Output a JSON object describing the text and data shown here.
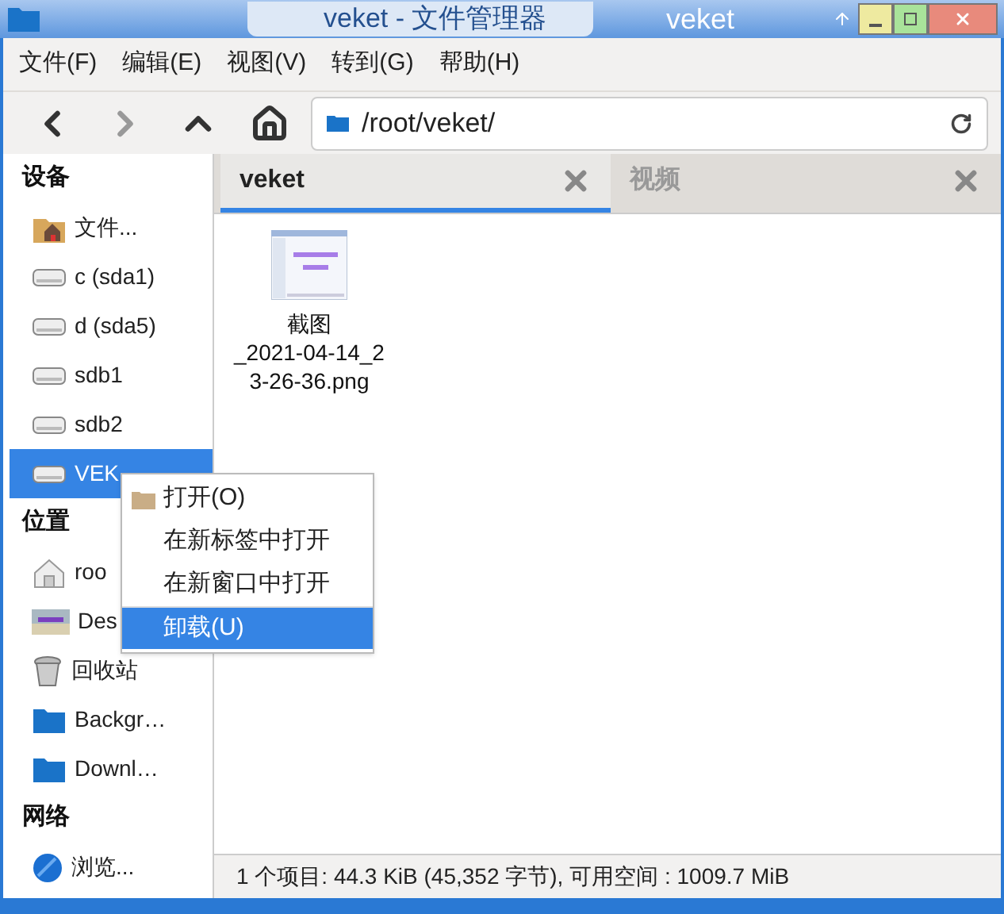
{
  "window": {
    "title": "veket - 文件管理器",
    "title_right": "veket"
  },
  "menu_bar": [
    "文件(F)",
    "编辑(E)",
    "视图(V)",
    "转到(G)",
    "帮助(H)"
  ],
  "location": {
    "value": "/root/veket/"
  },
  "sidebar": [
    {
      "kind": "header",
      "label": "设备"
    },
    {
      "kind": "homefolder",
      "label": "文件...",
      "selected": false
    },
    {
      "kind": "drive",
      "label": "c  (sda1)",
      "selected": false
    },
    {
      "kind": "drive",
      "label": "d  (sda5)",
      "selected": false
    },
    {
      "kind": "drive",
      "label": "sdb1",
      "selected": false
    },
    {
      "kind": "drive",
      "label": "sdb2",
      "selected": false
    },
    {
      "kind": "drive",
      "label": "VEK",
      "selected": true
    },
    {
      "kind": "header",
      "label": "位置"
    },
    {
      "kind": "house",
      "label": "roo",
      "selected": false
    },
    {
      "kind": "desktop",
      "label": "Des",
      "selected": false
    },
    {
      "kind": "trash",
      "label": "回收站",
      "selected": false
    },
    {
      "kind": "folder",
      "label": "Backgr…",
      "selected": false
    },
    {
      "kind": "folder",
      "label": "Downl…",
      "selected": false
    },
    {
      "kind": "header",
      "label": "网络"
    },
    {
      "kind": "globe",
      "label": "浏览...",
      "selected": false
    }
  ],
  "tabs": [
    {
      "label": "veket",
      "selected": true
    },
    {
      "label": "视频",
      "selected": false
    }
  ],
  "files": [
    {
      "kind": "picture",
      "name": "截图\n_2021-04-14_2\n3-26-36.png"
    }
  ],
  "context_menu": [
    {
      "label": "打开(O)",
      "icon": true,
      "selected": false
    },
    {
      "label": "在新标签中打开",
      "icon": false,
      "selected": false
    },
    {
      "label": "在新窗口中打开",
      "icon": false,
      "selected": false
    },
    {
      "label": "卸载(U)",
      "icon": false,
      "selected": true
    }
  ],
  "status_bar": "1 个项目: 44.3 KiB (45,352 字节), 可用空间 : 1009.7 MiB"
}
